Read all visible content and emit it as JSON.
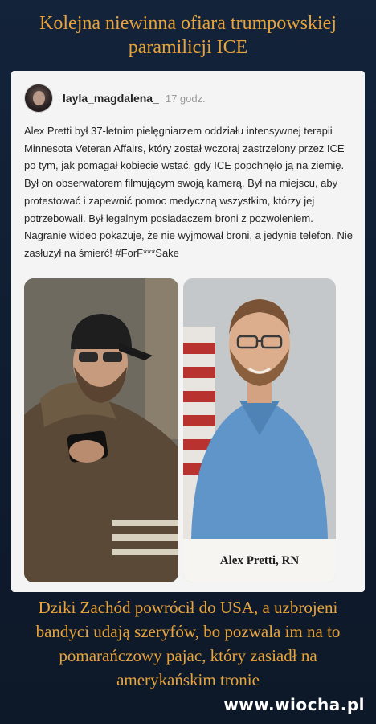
{
  "top_title": "Kolejna niewinna ofiara trumpowskiej paramilicji ICE",
  "post": {
    "username": "layla_magdalena_",
    "time": "17 godz.",
    "text": "Alex Pretti był 37-letnim pielęgniarzem oddziału intensywnej terapii Minnesota Veteran Affairs, który został wczoraj zastrzelony przez ICE po tym, jak pomagał kobiecie wstać, gdy ICE popchnęło ją na ziemię. Był on obserwatorem filmującym swoją kamerą. Był na miejscu, aby protestować i zapewnić pomoc medyczną wszystkim, którzy jej potrzebowali. Był legalnym posiadaczem broni z pozwoleniem. Nagranie wideo pokazuje, że nie wyjmował broni, a jedynie telefon. Nie zasłużył na śmierć! #ForF***Sake",
    "photo_caption": "Alex Pretti, RN"
  },
  "bottom_text": "Dziki Zachód powrócił do USA, a uzbrojeni bandyci udają szeryfów, bo pozwala im na to pomarańczowy pajac, który zasiadł na amerykańskim tronie",
  "watermark": "www.wiocha.pl",
  "colors": {
    "accent": "#e8a33a",
    "background": "#0f1b2c",
    "card": "#f4f4f4"
  }
}
